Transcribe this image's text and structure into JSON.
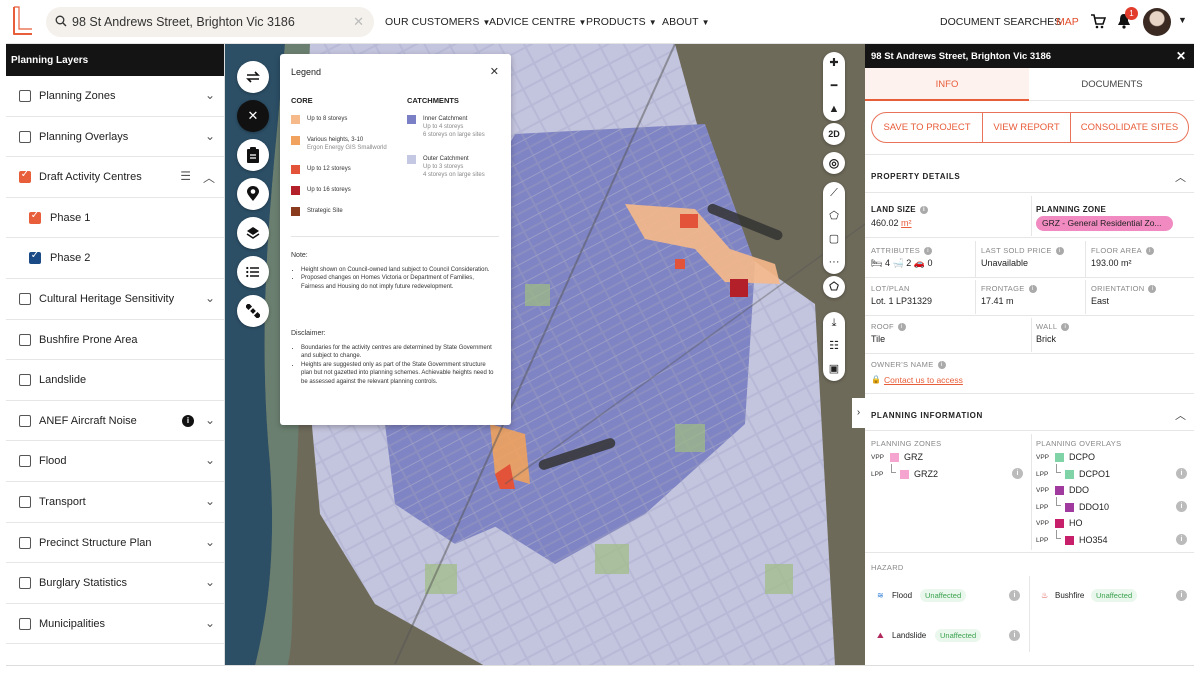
{
  "search": {
    "value": "98 St Andrews Street, Brighton Vic 3186"
  },
  "nav": [
    {
      "label": "OUR CUSTOMERS"
    },
    {
      "label": "ADVICE CENTRE"
    },
    {
      "label": "PRODUCTS"
    },
    {
      "label": "ABOUT"
    }
  ],
  "header": {
    "doc_searches": "DOCUMENT SEARCHES",
    "map": "MAP",
    "notifications": "1"
  },
  "left_panel": {
    "title": "Planning Layers",
    "layers": [
      {
        "label": "Planning Zones",
        "checked": false
      },
      {
        "label": "Planning Overlays",
        "checked": false
      },
      {
        "label": "Draft Activity Centres",
        "checked": true
      },
      {
        "label": "Phase 1",
        "checked": true
      },
      {
        "label": "Phase 2",
        "checked": true
      },
      {
        "label": "Cultural Heritage Sensitivity",
        "checked": false
      },
      {
        "label": "Bushfire Prone Area",
        "checked": false
      },
      {
        "label": "Landslide",
        "checked": false
      },
      {
        "label": "ANEF Aircraft Noise",
        "checked": false
      },
      {
        "label": "Flood",
        "checked": false
      },
      {
        "label": "Transport",
        "checked": false
      },
      {
        "label": "Precinct Structure Plan",
        "checked": false
      },
      {
        "label": "Burglary Statistics",
        "checked": false
      },
      {
        "label": "Municipalities",
        "checked": false
      }
    ]
  },
  "map_tools": {
    "mode_2d": "2D"
  },
  "legend": {
    "title": "Legend",
    "core_heading": "CORE",
    "catchments_heading": "CATCHMENTS",
    "core": [
      {
        "label": "Up to 8 storeys",
        "sub": "",
        "color": "#f6b98a"
      },
      {
        "label": "Various heights, 3-10",
        "sub": "Ergon Energy GIS Smallworld",
        "color": "#f0a25e"
      },
      {
        "label": "Up to 12 storeys",
        "sub": "",
        "color": "#e2533a"
      },
      {
        "label": "Up to 16 storeys",
        "sub": "",
        "color": "#b3202a"
      },
      {
        "label": "Strategic Site",
        "sub": "",
        "color": "#8a3b1e"
      }
    ],
    "catchments": [
      {
        "label": "Inner Catchment",
        "sub1": "Up to 4 storeys",
        "sub2": "6 storeys on large sites",
        "color": "#7a7fc6"
      },
      {
        "label": "Outer Catchment",
        "sub1": "Up to 3 storeys",
        "sub2": "4 storeys on large sites",
        "color": "#c5c8e2"
      }
    ],
    "note_heading": "Note:",
    "notes": [
      "Height shown on Council-owned land subject to Council Consideration.",
      "Proposed changes on Homes Victoria or Department of Families, Fairness and Housing do not imply future redevelopment."
    ],
    "disclaimer_heading": "Disclaimer:",
    "disclaimers": [
      "Boundaries for the activity centres are determined by State Government and subject to change.",
      "Heights are suggested only as part of the State Government structure plan but not gazetted into planning schemes. Achievable heights need to be assessed against the relevant planning controls."
    ]
  },
  "right_panel": {
    "title": "98 St Andrews Street, Brighton Vic 3186",
    "tabs": [
      {
        "label": "INFO"
      },
      {
        "label": "DOCUMENTS"
      }
    ],
    "actions": [
      {
        "label": "SAVE TO PROJECT"
      },
      {
        "label": "VIEW REPORT"
      },
      {
        "label": "CONSOLIDATE SITES"
      }
    ],
    "property": {
      "heading": "PROPERTY DETAILS",
      "land_size_label": "LAND SIZE",
      "land_size_value": "460.02",
      "land_size_unit": "m²",
      "planning_zone_label": "PLANNING ZONE",
      "planning_zone_value": "GRZ - General Residential Zo...",
      "attributes_label": "ATTRIBUTES",
      "beds": "4",
      "baths": "2",
      "cars": "0",
      "last_sold_label": "LAST SOLD PRICE",
      "last_sold_value": "Unavailable",
      "floor_area_label": "FLOOR AREA",
      "floor_area_value": "193.00 m²",
      "lot_plan_label": "LOT/PLAN",
      "lot_plan_value": "Lot. 1 LP31329",
      "frontage_label": "FRONTAGE",
      "frontage_value": "17.41 m",
      "orientation_label": "ORIENTATION",
      "orientation_value": "East",
      "roof_label": "ROOF",
      "roof_value": "Tile",
      "wall_label": "WALL",
      "wall_value": "Brick",
      "owner_label": "OWNER'S NAME",
      "owner_link": "Contact us to access"
    },
    "planning": {
      "heading": "PLANNING INFORMATION",
      "zones_label": "PLANNING ZONES",
      "overlays_label": "PLANNING OVERLAYS",
      "zones": [
        {
          "tag": "VPP",
          "label": "GRZ",
          "color": "#f5a3cf"
        },
        {
          "tag": "LPP",
          "label": "GRZ2",
          "color": "#f5a3cf"
        }
      ],
      "overlays": [
        {
          "tag": "VPP",
          "label": "DCPO",
          "color": "#7fd3a6"
        },
        {
          "tag": "LPP",
          "label": "DCPO1",
          "color": "#7fd3a6"
        },
        {
          "tag": "VPP",
          "label": "DDO",
          "color": "#a03a9e"
        },
        {
          "tag": "LPP",
          "label": "DDO10",
          "color": "#a03a9e"
        },
        {
          "tag": "VPP",
          "label": "HO",
          "color": "#c81f6a"
        },
        {
          "tag": "LPP",
          "label": "HO354",
          "color": "#c81f6a"
        }
      ]
    },
    "hazard": {
      "label": "HAZARD",
      "flood": "Flood",
      "bushfire": "Bushfire",
      "landslide": "Landslide",
      "status": "Unaffected"
    }
  }
}
